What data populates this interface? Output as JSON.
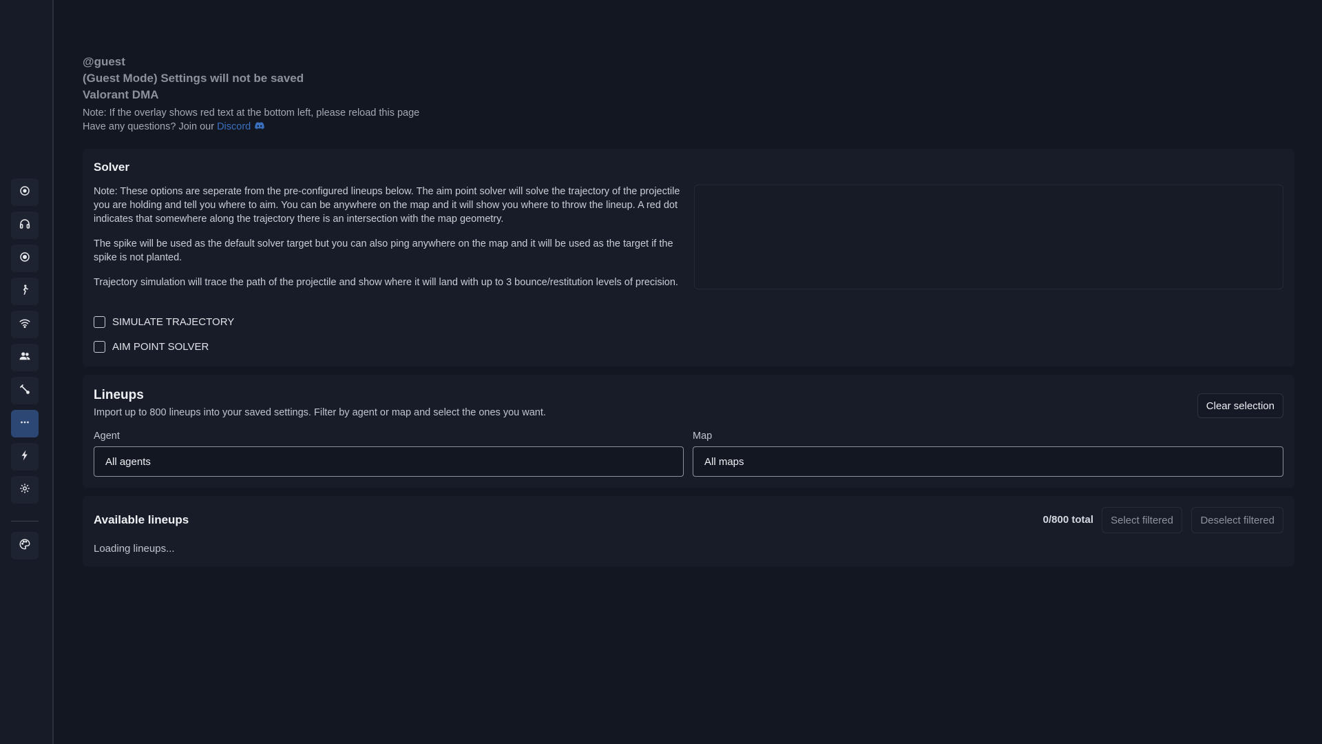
{
  "colors": {
    "background": "#121722",
    "sidebar": "#161b27",
    "panel": "#171c28",
    "active_nav": "#2c4773",
    "link": "#3b6fbf"
  },
  "sidebar": {
    "items": [
      {
        "icon": "crosshair-icon",
        "active": false
      },
      {
        "icon": "headphones-icon",
        "active": false
      },
      {
        "icon": "target-icon",
        "active": false
      },
      {
        "icon": "running-person-icon",
        "active": false
      },
      {
        "icon": "wifi-icon",
        "active": false
      },
      {
        "icon": "users-icon",
        "active": false
      },
      {
        "icon": "wrench-icon",
        "active": false
      },
      {
        "icon": "more-dots-icon",
        "active": true
      },
      {
        "icon": "lightning-icon",
        "active": false
      },
      {
        "icon": "gear-icon",
        "active": false
      },
      {
        "icon": "palette-icon",
        "active": false
      }
    ]
  },
  "header": {
    "username": "@guest",
    "guest_notice": "(Guest Mode) Settings will not be saved",
    "product": "Valorant DMA",
    "note": "Note: If the overlay shows red text at the bottom left, please reload this page",
    "questions_prefix": "Have any questions? Join our",
    "discord_link": "Discord",
    "discord_icon": "discord-icon"
  },
  "solver": {
    "title": "Solver",
    "paragraphs": [
      "Note: These options are seperate from the pre-configured lineups below. The aim point solver will solve the trajectory of the projectile you are holding and tell you where to aim. You can be anywhere on the map and it will show you where to throw the lineup. A red dot indicates that somewhere along the trajectory there is an intersection with the map geometry.",
      "The spike will be used as the default solver target but you can also ping anywhere on the map and it will be used as the target if the spike is not planted.",
      "Trajectory simulation will trace the path of the projectile and show where it will land with up to 3 bounce/restitution levels of precision."
    ],
    "simulate_trajectory": {
      "label": "SIMULATE TRAJECTORY",
      "checked": false
    },
    "aim_point_solver": {
      "label": "AIM POINT SOLVER",
      "checked": false
    }
  },
  "lineups": {
    "title": "Lineups",
    "description": "Import up to 800 lineups into your saved settings. Filter by agent or map and select the ones you want.",
    "clear_button": "Clear selection",
    "agent_label": "Agent",
    "agent_value": "All agents",
    "map_label": "Map",
    "map_value": "All maps"
  },
  "available": {
    "title": "Available lineups",
    "total": "0/800 total",
    "select_filtered": "Select filtered",
    "deselect_filtered": "Deselect filtered",
    "loading": "Loading lineups..."
  }
}
